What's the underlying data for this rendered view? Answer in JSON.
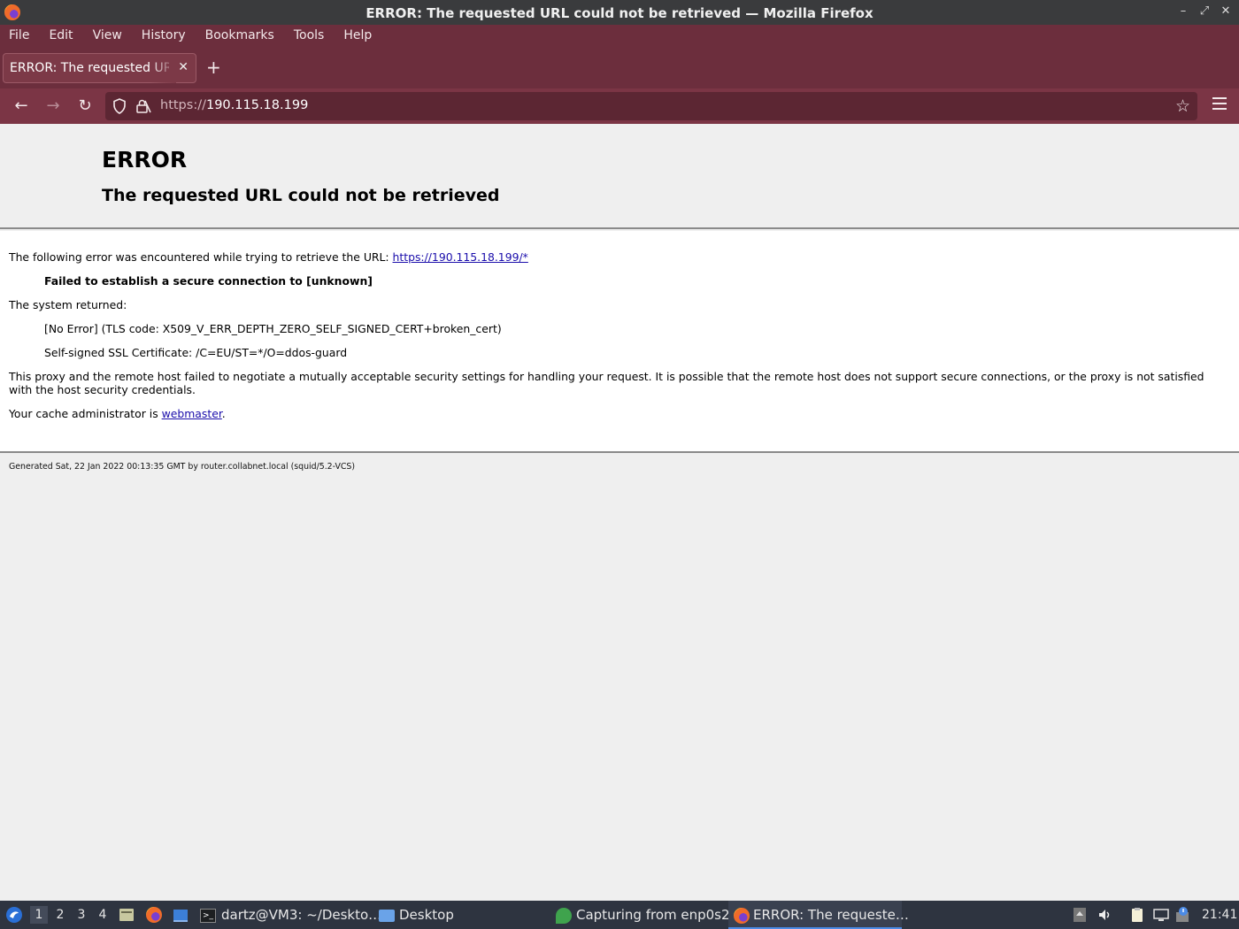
{
  "window": {
    "title": "ERROR: The requested URL could not be retrieved — Mozilla Firefox",
    "controls": [
      "–",
      "⤢",
      "✕"
    ]
  },
  "menu": [
    {
      "label": "File"
    },
    {
      "label": "Edit"
    },
    {
      "label": "View"
    },
    {
      "label": "History"
    },
    {
      "label": "Bookmarks"
    },
    {
      "label": "Tools"
    },
    {
      "label": "Help"
    }
  ],
  "tab": {
    "label": "ERROR: The requested URL could not be retrieved",
    "close": "✕",
    "new_tab": "+"
  },
  "nav": {
    "back": "←",
    "forward": "→",
    "reload": "↻",
    "url_proto": "https://",
    "url_host": "190.115.18.199",
    "bookmark_star": "☆"
  },
  "page": {
    "h1": "ERROR",
    "h2": "The requested URL could not be retrieved",
    "line1_prefix": "The following error was encountered while trying to retrieve the URL: ",
    "line1_link": "https://190.115.18.199/*",
    "failed": "Failed to establish a secure connection to [unknown]",
    "system_returned": "The system returned:",
    "tls_code": "[No Error] (TLS code: X509_V_ERR_DEPTH_ZERO_SELF_SIGNED_CERT+broken_cert)",
    "cert": "Self-signed SSL Certificate: /C=EU/ST=*/O=ddos-guard",
    "explanation": "This proxy and the remote host failed to negotiate a mutually acceptable security settings for handling your request. It is possible that the remote host does not support secure connections, or the proxy is not satisfied with the host security credentials.",
    "cache_prefix": "Your cache administrator is ",
    "cache_link": "webmaster",
    "cache_suffix": ".",
    "footer": "Generated Sat, 22 Jan 2022 00:13:35 GMT by router.collabnet.local (squid/5.2-VCS)"
  },
  "taskbar": {
    "workspaces": [
      "1",
      "2",
      "3",
      "4"
    ],
    "tasks": [
      {
        "label": "dartz@VM3: ~/Deskto…"
      },
      {
        "label": "Desktop"
      },
      {
        "label": "Capturing from enp0s2"
      },
      {
        "label": "ERROR: The requeste…"
      }
    ],
    "clock": "21:41"
  },
  "colors": {
    "chrome": "#6c2e3d",
    "urlbar": "#5c2633",
    "link": "#1a0dab",
    "taskbar": "#2e3440"
  }
}
